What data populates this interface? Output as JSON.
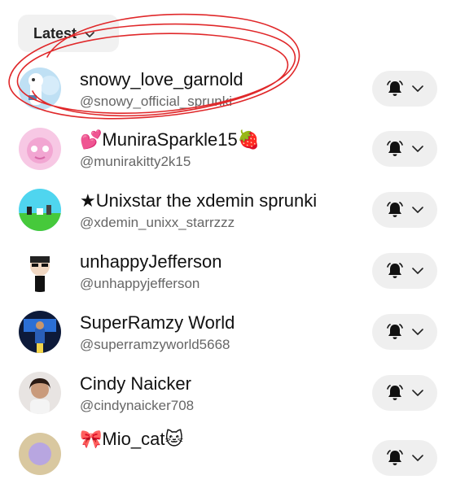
{
  "sort": {
    "label": "Latest",
    "icon": "chevron-down-icon"
  },
  "accounts": [
    {
      "name": "snowy_love_garnold",
      "handle": "@snowy_official_sprunki"
    },
    {
      "name": "💕MuniraSparkle15🍓",
      "handle": "@munirakitty2k15"
    },
    {
      "name": "★Unixstar the xdemin sprunki",
      "handle": "@xdemin_unixx_starrzzz"
    },
    {
      "name": "unhappyJefferson",
      "handle": "@unhappyjefferson"
    },
    {
      "name": "SuperRamzy World",
      "handle": "@superramzyworld5668"
    },
    {
      "name": "Cindy Naicker",
      "handle": "@cindynaicker708"
    },
    {
      "name": "🎀Mio_cat🐱",
      "handle": ""
    }
  ],
  "colors": {
    "annotation": "#e0282a",
    "pill": "#efefef",
    "secondary_text": "#666666"
  }
}
